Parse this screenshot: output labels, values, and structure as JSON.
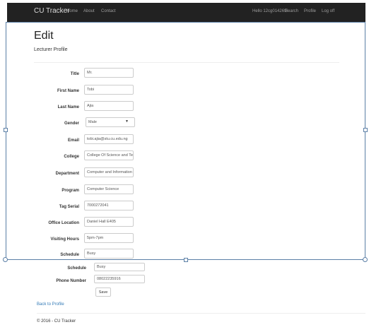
{
  "navbar": {
    "brand": "CU Tracker",
    "links": [
      "Home",
      "About",
      "Contact"
    ],
    "greeting": "Hello 12cg014269!",
    "right_links": [
      "Search",
      "Profile",
      "Log off"
    ]
  },
  "page": {
    "title": "Edit",
    "subtitle": "Lecturer Profile"
  },
  "form": {
    "title": {
      "label": "Title",
      "value": "Mr."
    },
    "first_name": {
      "label": "First Name",
      "value": "Tobi"
    },
    "last_name": {
      "label": "Last Name",
      "value": "Ajia"
    },
    "gender": {
      "label": "Gender",
      "value": "Male"
    },
    "email": {
      "label": "Email",
      "value": "tobi.ajia@stu.cu.edu.ng"
    },
    "college": {
      "label": "College",
      "value": "College Of Science and Te"
    },
    "department": {
      "label": "Department",
      "value": "Computer and Information"
    },
    "program": {
      "label": "Program",
      "value": "Computer Science"
    },
    "tag_serial": {
      "label": "Tag Serial",
      "value": "7000272041"
    },
    "office_location": {
      "label": "Office Location",
      "value": "Daniel Hall E405"
    },
    "visiting_hours": {
      "label": "Visiting Hours",
      "value": "5pm-7pm"
    },
    "schedule": {
      "label": "Schedule",
      "value": "Busy"
    },
    "schedule_dup": {
      "label": "Schedule",
      "value": "Busy"
    },
    "phone_number": {
      "label": "Phone Number",
      "value": "08022235916"
    },
    "save_label": "Save"
  },
  "links": {
    "back": "Back to Profile"
  },
  "footer": {
    "text": "© 2016 - CU Tracker"
  },
  "colors": {
    "navbar_bg": "#222222",
    "link": "#337ab7",
    "selection": "#5b7fa6"
  }
}
